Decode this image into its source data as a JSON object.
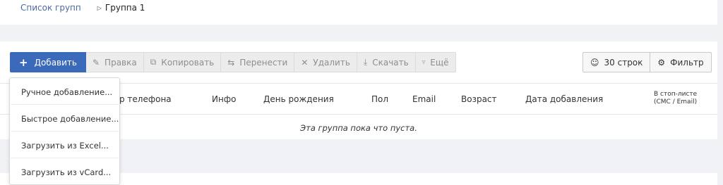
{
  "breadcrumb": {
    "parent": "Список групп",
    "separator_icon": "caret-right-icon",
    "current": "Группа 1"
  },
  "toolbar": {
    "add": "Добавить",
    "edit": "Правка",
    "copy": "Копировать",
    "move": "Перенести",
    "delete": "Удалить",
    "download": "Скачать",
    "more": "Ещё"
  },
  "right_tools": {
    "rows": "30 строк",
    "filter": "Фильтр"
  },
  "table": {
    "columns": {
      "phone": "р телефона",
      "info": "Инфо",
      "birthday": "День рождения",
      "gender": "Пол",
      "email": "Email",
      "age": "Возраст",
      "added": "Дата добавления",
      "stoplist_line1": "В стоп-листе",
      "stoplist_line2": "(СМС / Email)"
    },
    "empty_message": "Эта группа пока что пуста."
  },
  "add_menu": {
    "items": [
      "Ручное добавление...",
      "Быстрое добавление...",
      "Загрузить из Excel...",
      "Загрузить из vCard..."
    ]
  },
  "colors": {
    "primary": "#3a6ab9",
    "link": "#4a6aa5",
    "background": "#f1f2f6"
  }
}
